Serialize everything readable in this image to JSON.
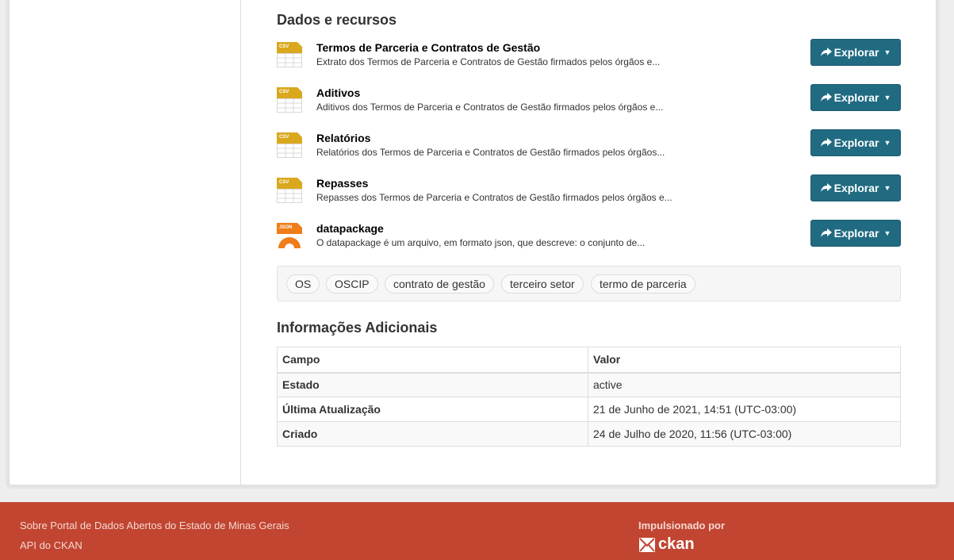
{
  "resources_heading": "Dados e recursos",
  "explore_label": "Explorar",
  "resources": [
    {
      "format": "CSV",
      "title": "Termos de Parceria e Contratos de Gestão",
      "description": "Extrato dos Termos de Parceria e Contratos de Gestão firmados pelos órgãos e..."
    },
    {
      "format": "CSV",
      "title": "Aditivos",
      "description": "Aditivos dos Termos de Parceria e Contratos de Gestão firmados pelos órgãos e..."
    },
    {
      "format": "CSV",
      "title": "Relatórios",
      "description": "Relatórios dos Termos de Parceria e Contratos de Gestão firmados pelos órgãos..."
    },
    {
      "format": "CSV",
      "title": "Repasses",
      "description": "Repasses dos Termos de Parceria e Contratos de Gestão firmados pelos órgãos e..."
    },
    {
      "format": "JSON",
      "title": "datapackage",
      "description": "O datapackage é um arquivo, em formato json, que descreve: o conjunto de..."
    }
  ],
  "tags": [
    "OS",
    "OSCIP",
    "contrato de gestão",
    "terceiro setor",
    "termo de parceria"
  ],
  "additional_info": {
    "heading": "Informações Adicionais",
    "columns": [
      "Campo",
      "Valor"
    ],
    "rows": [
      {
        "field": "Estado",
        "value": "active"
      },
      {
        "field": "Última Atualização",
        "value": "21 de Junho de 2021, 14:51 (UTC-03:00)"
      },
      {
        "field": "Criado",
        "value": "24 de Julho de 2020, 11:56 (UTC-03:00)"
      }
    ]
  },
  "footer": {
    "about_link": "Sobre Portal de Dados Abertos do Estado de Minas Gerais",
    "api_link": "API do CKAN",
    "powered_by": "Impulsionado por",
    "ckan_logo_text": "ckan"
  },
  "colors": {
    "explore_button": "#206b82",
    "csv_icon": "#d9a81d",
    "json_icon": "#f07d1a",
    "footer_bg": "#c14531"
  },
  "icons": {
    "share": "share-icon",
    "caret": "caret-down-icon",
    "csv": "csv-file-icon",
    "json": "json-file-icon"
  }
}
